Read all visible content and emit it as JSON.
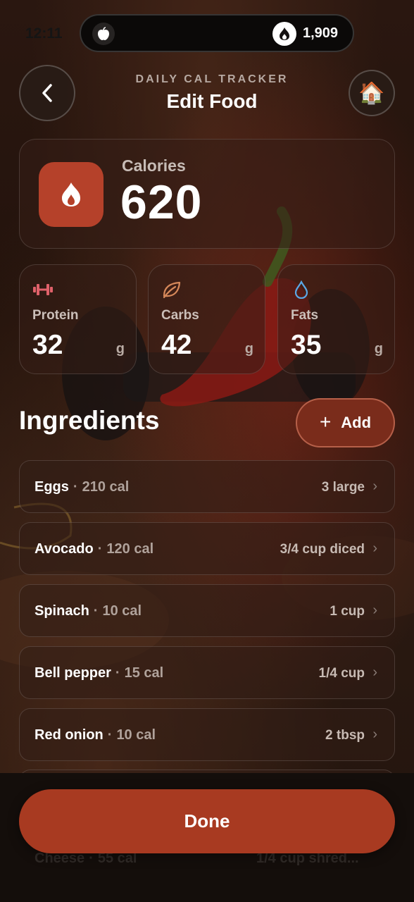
{
  "status": {
    "time": "12:11"
  },
  "top_pill": {
    "apple_icon": "apple-icon",
    "streak_icon": "flame-icon",
    "streak_count": "1,909"
  },
  "header": {
    "subtitle": "DAILY CAL TRACKER",
    "title": "Edit Food",
    "back_icon": "chevron-left-icon",
    "home_icon": "🏠"
  },
  "calories": {
    "label": "Calories",
    "value": "620",
    "icon": "flame-icon",
    "accent": "#b5412a"
  },
  "macros": [
    {
      "label": "Protein",
      "value": "32",
      "unit": "g",
      "icon": "dumbbell-icon",
      "color": "#e0616a"
    },
    {
      "label": "Carbs",
      "value": "42",
      "unit": "g",
      "icon": "leaf-icon",
      "color": "#d6885a"
    },
    {
      "label": "Fats",
      "value": "35",
      "unit": "g",
      "icon": "drop-icon",
      "color": "#5aa8e6"
    }
  ],
  "ingredients": {
    "title": "Ingredients",
    "add_label": "Add",
    "items": [
      {
        "name": "Eggs",
        "separator": "·",
        "calories": "210 cal",
        "quantity": "3 large"
      },
      {
        "name": "Avocado",
        "separator": "·",
        "calories": "120 cal",
        "quantity": "3/4 cup diced"
      },
      {
        "name": "Spinach",
        "separator": "·",
        "calories": "10 cal",
        "quantity": "1 cup"
      },
      {
        "name": "Bell pepper",
        "separator": "·",
        "calories": "15 cal",
        "quantity": "1/4 cup"
      },
      {
        "name": "Red onion",
        "separator": "·",
        "calories": "10 cal",
        "quantity": "2 tbsp"
      },
      {
        "name": "Cheese",
        "separator": "·",
        "calories": "55 cal",
        "quantity": "1/4 cup shred..."
      }
    ]
  },
  "done_label": "Done",
  "colors": {
    "button": "#a83a21",
    "add_button": "#7a2c1b"
  }
}
